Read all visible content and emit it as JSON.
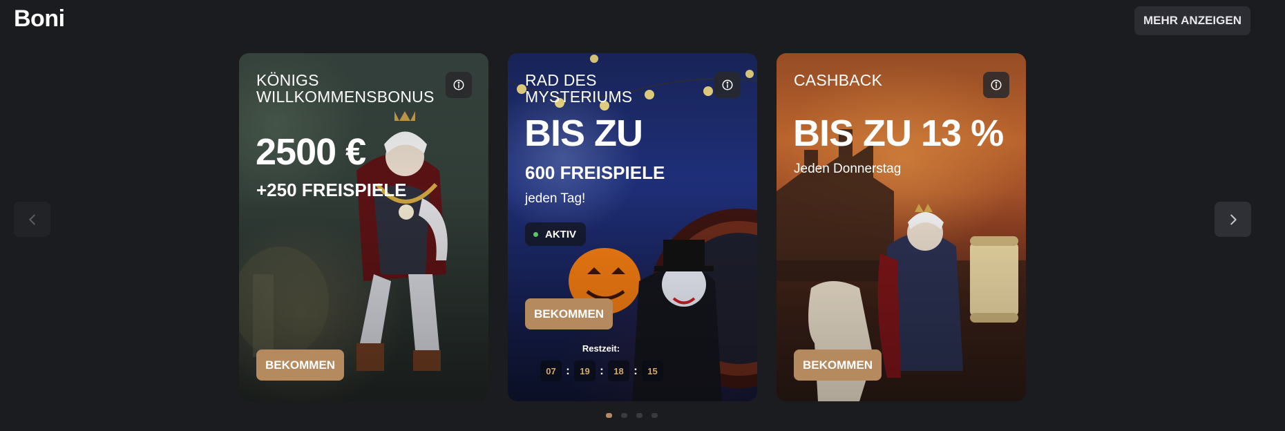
{
  "header": {
    "title": "Boni",
    "more_label": "MEHR ANZEIGEN"
  },
  "carousel": {
    "prev_icon": "chevron-left-icon",
    "next_icon": "chevron-right-icon",
    "dots_count": 4,
    "active_dot": 0
  },
  "cards": [
    {
      "title": "KÖNIGS WILLKOMMENSBONUS",
      "amount": "2500 €",
      "sub": "+250 FREISPIELE",
      "button": "BEKOMMEN"
    },
    {
      "title": "RAD DES MYSTERIUMS",
      "amount": "BIS ZU",
      "sub": "600 FREISPIELE",
      "note": "jeden Tag!",
      "status": "AKTIV",
      "button": "BEKOMMEN",
      "timer_label": "Restzeit:",
      "timer": [
        "07",
        "19",
        "18",
        "15"
      ]
    },
    {
      "title": "CASHBACK",
      "amount": "BIS ZU 13 %",
      "note": "Jeden Donnerstag",
      "button": "BEKOMMEN"
    }
  ],
  "colors": {
    "background": "#1b1c20",
    "accent": "#b48a5e",
    "status_active": "#5ec36b",
    "timer_digits": "#d6a968"
  }
}
